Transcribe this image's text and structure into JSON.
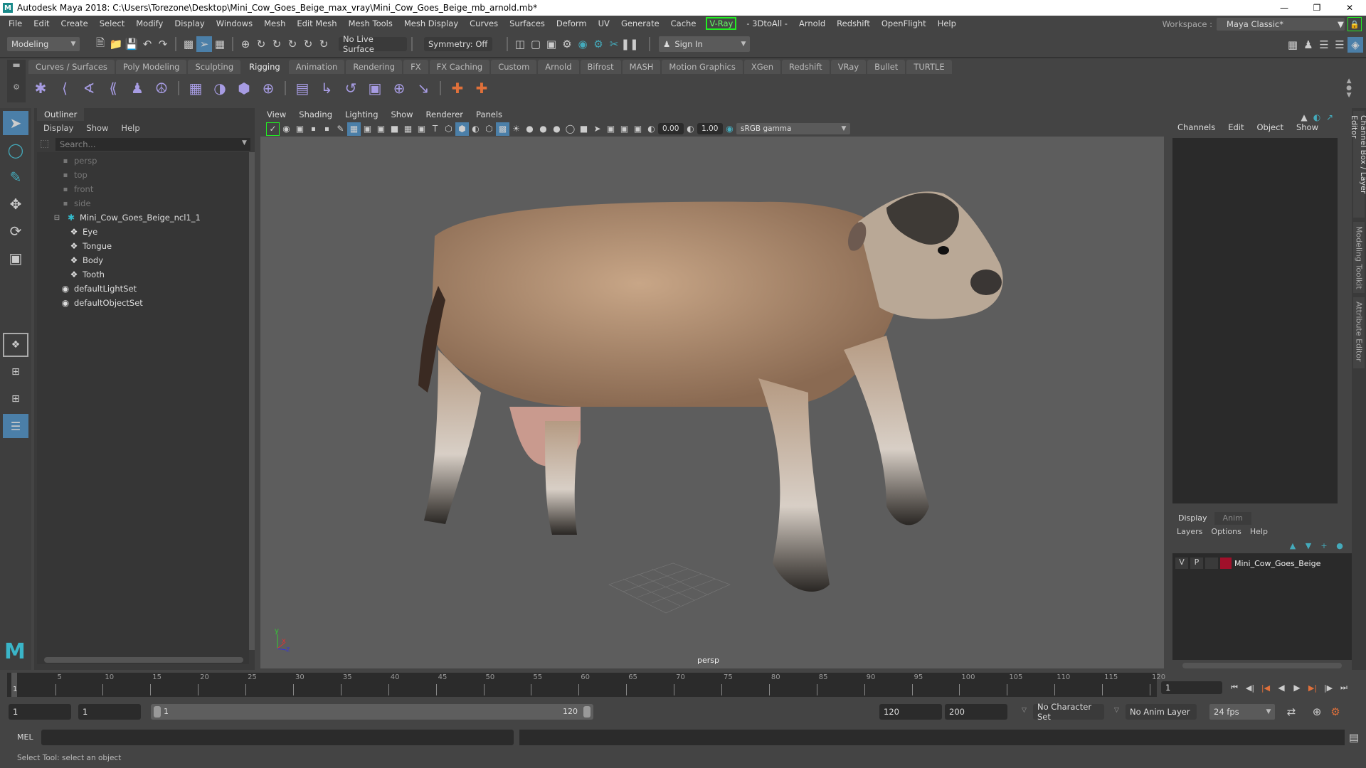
{
  "window": {
    "title": "Autodesk Maya 2018: C:\\Users\\Torezone\\Desktop\\Mini_Cow_Goes_Beige_max_vray\\Mini_Cow_Goes_Beige_mb_arnold.mb*",
    "controls": [
      "minimize",
      "restore",
      "close"
    ]
  },
  "menubar": [
    "File",
    "Edit",
    "Create",
    "Select",
    "Modify",
    "Display",
    "Windows",
    "Mesh",
    "Edit Mesh",
    "Mesh Tools",
    "Mesh Display",
    "Curves",
    "Surfaces",
    "Deform",
    "UV",
    "Generate",
    "Cache",
    "V-Ray",
    "- 3DtoAll -",
    "Arnold",
    "Redshift",
    "OpenFlight",
    "Help"
  ],
  "workspace": {
    "label": "Workspace :",
    "value": "Maya Classic*"
  },
  "statusline": {
    "menuset": "Modeling",
    "live_surface": "No Live Surface",
    "symmetry": "Symmetry: Off",
    "sign_in": "Sign In"
  },
  "shelf": {
    "tabs": [
      "Curves / Surfaces",
      "Poly Modeling",
      "Sculpting",
      "Rigging",
      "Animation",
      "Rendering",
      "FX",
      "FX Caching",
      "Custom",
      "Arnold",
      "Bifrost",
      "MASH",
      "Motion Graphics",
      "XGen",
      "Redshift",
      "VRay",
      "Bullet",
      "TURTLE"
    ],
    "active_tab": "Rigging",
    "icons": [
      "joint-tool-icon",
      "ik-handle-icon",
      "ik-spline-icon",
      "bind-skin-icon",
      "humanik-icon",
      "quick-rig-icon",
      "paint-weights-icon",
      "blend-shape-icon",
      "lattice-icon",
      "cluster-icon",
      "parent-constraint-icon",
      "point-constraint-icon",
      "orient-constraint-icon",
      "scale-constraint-icon",
      "aim-constraint-icon",
      "pole-vector-icon",
      "bone-icon",
      "bone-link-icon"
    ]
  },
  "outliner": {
    "tab": "Outliner",
    "menu": [
      "Display",
      "Show",
      "Help"
    ],
    "search_placeholder": "Search...",
    "items": [
      {
        "label": "persp",
        "type": "camera",
        "indent": 0
      },
      {
        "label": "top",
        "type": "camera",
        "indent": 0
      },
      {
        "label": "front",
        "type": "camera",
        "indent": 0
      },
      {
        "label": "side",
        "type": "camera",
        "indent": 0
      },
      {
        "label": "Mini_Cow_Goes_Beige_ncl1_1",
        "type": "group",
        "indent": 0,
        "expanded": true
      },
      {
        "label": "Eye",
        "type": "mesh",
        "indent": 1
      },
      {
        "label": "Tongue",
        "type": "mesh",
        "indent": 1
      },
      {
        "label": "Body",
        "type": "mesh",
        "indent": 1
      },
      {
        "label": "Tooth",
        "type": "mesh",
        "indent": 1
      },
      {
        "label": "defaultLightSet",
        "type": "set",
        "indent": 0
      },
      {
        "label": "defaultObjectSet",
        "type": "set",
        "indent": 0
      }
    ]
  },
  "viewport": {
    "menu": [
      "View",
      "Shading",
      "Lighting",
      "Show",
      "Renderer",
      "Panels"
    ],
    "exposure": "0.00",
    "gamma": "1.00",
    "color_space": "sRGB gamma",
    "camera_label": "persp",
    "axis": {
      "y": "y",
      "x": "x",
      "z": "z"
    }
  },
  "channel_box": {
    "menu": [
      "Channels",
      "Edit",
      "Object",
      "Show"
    ]
  },
  "layer_editor": {
    "tabs": [
      "Display",
      "Anim"
    ],
    "active_tab": "Display",
    "menu": [
      "Layers",
      "Options",
      "Help"
    ],
    "layers": [
      {
        "v": "V",
        "p": "P",
        "name": "Mini_Cow_Goes_Beige",
        "color": "#a0102a"
      }
    ]
  },
  "side_tabs": [
    "Channel Box / Layer Editor",
    "Modeling Toolkit",
    "Attribute Editor"
  ],
  "timeline": {
    "ticks": [
      5,
      10,
      15,
      20,
      25,
      30,
      35,
      40,
      45,
      50,
      55,
      60,
      65,
      70,
      75,
      80,
      85,
      90,
      95,
      100,
      105,
      110,
      115,
      120
    ],
    "current_frame": "1",
    "current_frame_field": "1"
  },
  "range": {
    "start": "1",
    "playback_start": "1",
    "slider_start": "1",
    "slider_end": "120",
    "playback_end": "120",
    "end": "200",
    "character_set": "No Character Set",
    "anim_layer": "No Anim Layer",
    "fps": "24 fps"
  },
  "command_line": {
    "label": "MEL"
  },
  "help_line": "Select Tool: select an object",
  "colors": {
    "accent": "#4b7fa8",
    "vray_green": "#22dd22",
    "layer_color": "#a0102a"
  }
}
